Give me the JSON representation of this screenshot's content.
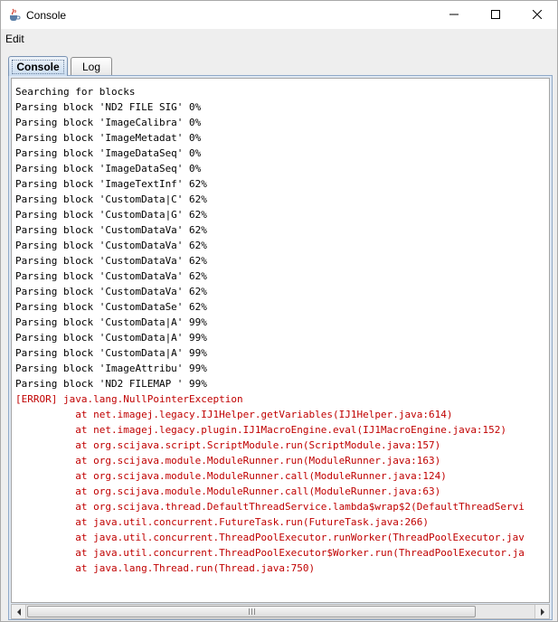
{
  "window": {
    "title": "Console",
    "app_icon": "java-cup-icon",
    "controls": {
      "minimize": "minimize-icon",
      "maximize": "maximize-icon",
      "close": "close-icon"
    }
  },
  "menu": {
    "items": [
      {
        "label": "Edit"
      }
    ]
  },
  "tabs": [
    {
      "label": "Console",
      "active": true
    },
    {
      "label": "Log",
      "active": false
    }
  ],
  "colors": {
    "normal_text": "#000000",
    "error_text": "#c00000",
    "active_tab": "#c9dcf0"
  },
  "console": {
    "lines": [
      {
        "type": "normal",
        "text": "Searching for blocks"
      },
      {
        "type": "normal",
        "text": "Parsing block 'ND2 FILE SIG' 0%"
      },
      {
        "type": "normal",
        "text": "Parsing block 'ImageCalibra' 0%"
      },
      {
        "type": "normal",
        "text": "Parsing block 'ImageMetadat' 0%"
      },
      {
        "type": "normal",
        "text": "Parsing block 'ImageDataSeq' 0%"
      },
      {
        "type": "normal",
        "text": "Parsing block 'ImageDataSeq' 0%"
      },
      {
        "type": "normal",
        "text": "Parsing block 'ImageTextInf' 62%"
      },
      {
        "type": "normal",
        "text": "Parsing block 'CustomData|C' 62%"
      },
      {
        "type": "normal",
        "text": "Parsing block 'CustomData|G' 62%"
      },
      {
        "type": "normal",
        "text": "Parsing block 'CustomDataVa' 62%"
      },
      {
        "type": "normal",
        "text": "Parsing block 'CustomDataVa' 62%"
      },
      {
        "type": "normal",
        "text": "Parsing block 'CustomDataVa' 62%"
      },
      {
        "type": "normal",
        "text": "Parsing block 'CustomDataVa' 62%"
      },
      {
        "type": "normal",
        "text": "Parsing block 'CustomDataVa' 62%"
      },
      {
        "type": "normal",
        "text": "Parsing block 'CustomDataSe' 62%"
      },
      {
        "type": "normal",
        "text": "Parsing block 'CustomData|A' 99%"
      },
      {
        "type": "normal",
        "text": "Parsing block 'CustomData|A' 99%"
      },
      {
        "type": "normal",
        "text": "Parsing block 'CustomData|A' 99%"
      },
      {
        "type": "normal",
        "text": "Parsing block 'ImageAttribu' 99%"
      },
      {
        "type": "normal",
        "text": "Parsing block 'ND2 FILEMAP ' 99%"
      },
      {
        "type": "error",
        "text": "[ERROR] java.lang.NullPointerException"
      },
      {
        "type": "error",
        "text": "          at net.imagej.legacy.IJ1Helper.getVariables(IJ1Helper.java:614)"
      },
      {
        "type": "error",
        "text": "          at net.imagej.legacy.plugin.IJ1MacroEngine.eval(IJ1MacroEngine.java:152)"
      },
      {
        "type": "error",
        "text": "          at org.scijava.script.ScriptModule.run(ScriptModule.java:157)"
      },
      {
        "type": "error",
        "text": "          at org.scijava.module.ModuleRunner.run(ModuleRunner.java:163)"
      },
      {
        "type": "error",
        "text": "          at org.scijava.module.ModuleRunner.call(ModuleRunner.java:124)"
      },
      {
        "type": "error",
        "text": "          at org.scijava.module.ModuleRunner.call(ModuleRunner.java:63)"
      },
      {
        "type": "error",
        "text": "          at org.scijava.thread.DefaultThreadService.lambda$wrap$2(DefaultThreadServi"
      },
      {
        "type": "error",
        "text": "          at java.util.concurrent.FutureTask.run(FutureTask.java:266)"
      },
      {
        "type": "error",
        "text": "          at java.util.concurrent.ThreadPoolExecutor.runWorker(ThreadPoolExecutor.jav"
      },
      {
        "type": "error",
        "text": "          at java.util.concurrent.ThreadPoolExecutor$Worker.run(ThreadPoolExecutor.ja"
      },
      {
        "type": "error",
        "text": "          at java.lang.Thread.run(Thread.java:750)"
      }
    ]
  },
  "scrollbar": {
    "left_arrow": "arrow-left-icon",
    "right_arrow": "arrow-right-icon",
    "thumb_grip": "grip-icon"
  }
}
